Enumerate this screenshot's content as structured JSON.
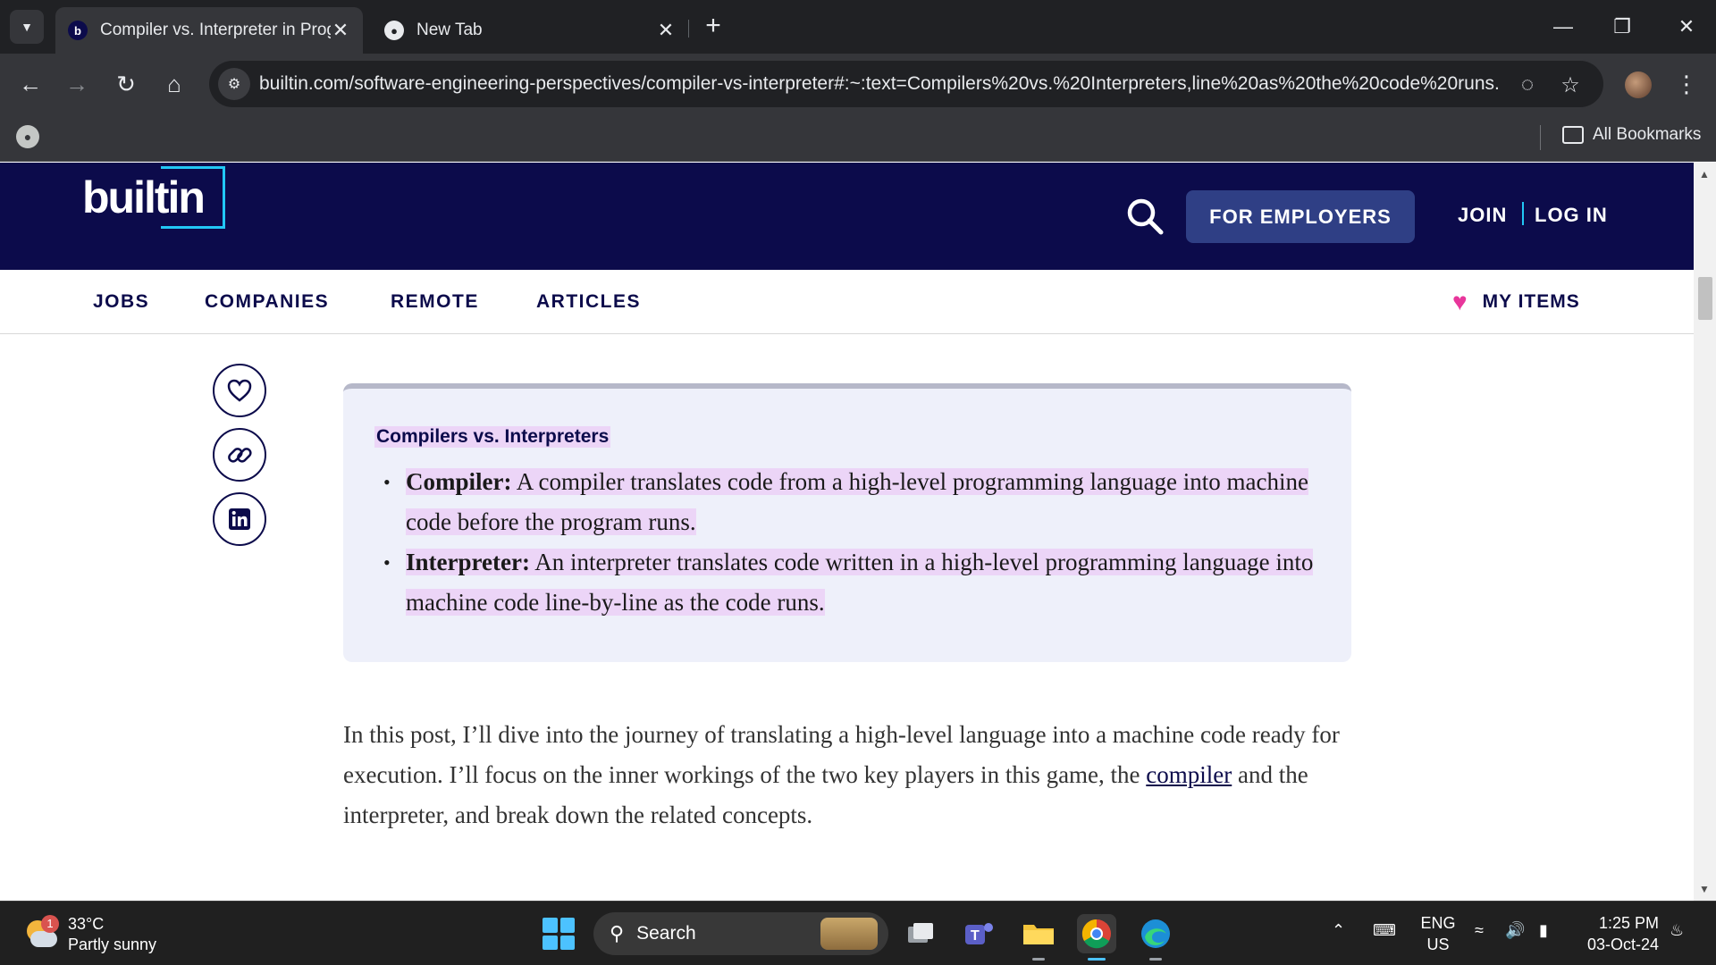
{
  "browser": {
    "tabs": [
      {
        "title": "Compiler vs. Interpreter in Prog",
        "favicon": "b",
        "active": true
      },
      {
        "title": "New Tab",
        "active": false
      }
    ],
    "url": "builtin.com/software-engineering-perspectives/compiler-vs-interpreter#:~:text=Compilers%20vs.%20Interpreters,line%20as%20the%20code%20runs.",
    "bookmarks_all_label": "All Bookmarks"
  },
  "site": {
    "logo_text": "builtin",
    "employers_label": "FOR EMPLOYERS",
    "join_label": "JOIN",
    "login_label": "LOG IN",
    "nav": [
      "JOBS",
      "COMPANIES",
      "REMOTE",
      "ARTICLES"
    ],
    "my_items_label": "MY ITEMS",
    "accent_color": "#0c0b4b",
    "highlight_color": "#ecd5f7"
  },
  "article": {
    "summary_heading": "Compilers vs. Interpreters",
    "summary_items": [
      {
        "term": "Compiler:",
        "text": "A compiler translates code from a high-level programming language into machine code before the program runs."
      },
      {
        "term": "Interpreter:",
        "text": "An interpreter translates code written in a high-level programming language into machine code line-by-line as the code runs."
      }
    ],
    "body_before_link": "In this post, I’ll dive into the journey of translating a high-level language into a machine code ready for execution. I’ll focus on the inner workings of the two key players in this game, the ",
    "body_link": "compiler",
    "body_after_link": " and the interpreter, and break down the related concepts."
  },
  "taskbar": {
    "weather_temp": "33°C",
    "weather_desc": "Partly sunny",
    "weather_badge": "1",
    "search_placeholder": "Search",
    "lang_top": "ENG",
    "lang_bottom": "US",
    "time": "1:25 PM",
    "date": "03-Oct-24"
  }
}
